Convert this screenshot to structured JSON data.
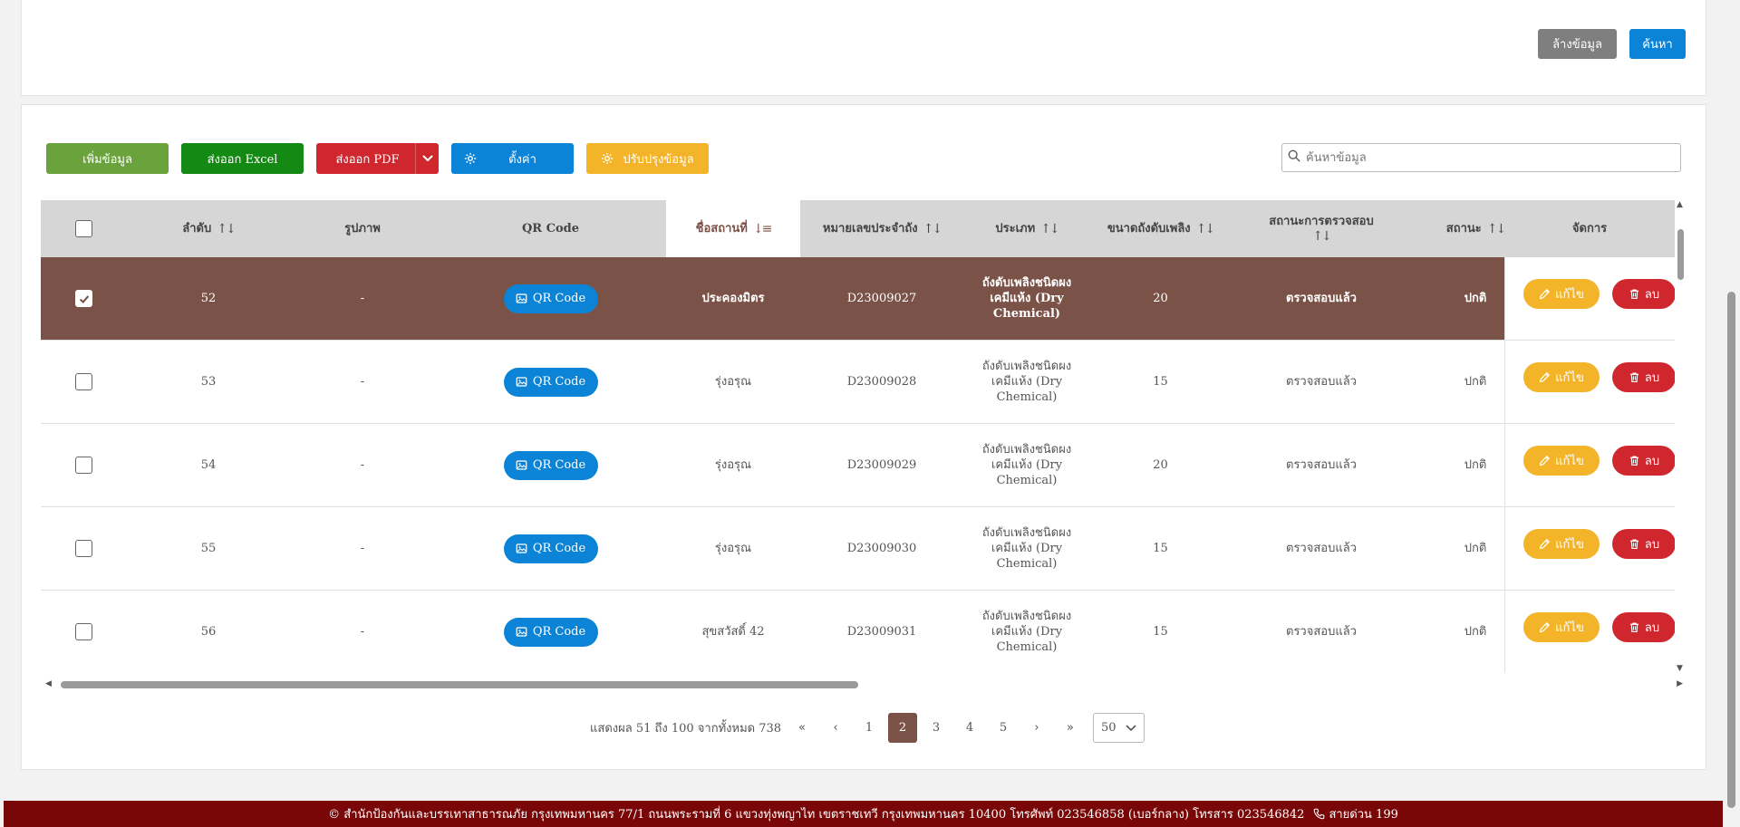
{
  "filter": {
    "clear_label": "ล้างข้อมูล",
    "search_label": "ค้นหา"
  },
  "toolbar": {
    "add_label": "เพิ่มข้อมูล",
    "excel_label": "ส่งออก Excel",
    "pdf_label": "ส่งออก PDF",
    "settings_label": "ตั้งค่า",
    "update_label": "ปรับปรุงข้อมูล",
    "search_placeholder": "ค้นหาข้อมูล"
  },
  "table": {
    "headers": {
      "order": "ลำดับ",
      "image": "รูปภาพ",
      "qr": "QR Code",
      "location": "ชื่อสถานที่",
      "tank_no": "หมายเลขประจำถัง",
      "type": "ประเภท",
      "size": "ขนาดถังดับเพลิง",
      "inspection_l1": "สถานะการตรวจสอบ",
      "status": "สถานะ",
      "manage": "จัดการ"
    },
    "sorted_column": "location",
    "qr_button_label": "QR Code",
    "edit_label": "แก้ไข",
    "delete_label": "ลบ",
    "rows": [
      {
        "selected": true,
        "order": "52",
        "image": "-",
        "location": "ประคองมิตร",
        "tank_no": "D23009027",
        "type_l1": "ถังดับเพลิงชนิดผง",
        "type_l2": "เคมีแห้ง (Dry",
        "type_l3": "Chemical)",
        "size": "20",
        "inspection": "ตรวจสอบแล้ว",
        "status": "ปกติ"
      },
      {
        "selected": false,
        "order": "53",
        "image": "-",
        "location": "รุ่งอรุณ",
        "tank_no": "D23009028",
        "type_l1": "ถังดับเพลิงชนิดผง",
        "type_l2": "เคมีแห้ง (Dry",
        "type_l3": "Chemical)",
        "size": "15",
        "inspection": "ตรวจสอบแล้ว",
        "status": "ปกติ"
      },
      {
        "selected": false,
        "order": "54",
        "image": "-",
        "location": "รุ่งอรุณ",
        "tank_no": "D23009029",
        "type_l1": "ถังดับเพลิงชนิดผง",
        "type_l2": "เคมีแห้ง (Dry",
        "type_l3": "Chemical)",
        "size": "20",
        "inspection": "ตรวจสอบแล้ว",
        "status": "ปกติ"
      },
      {
        "selected": false,
        "order": "55",
        "image": "-",
        "location": "รุ่งอรุณ",
        "tank_no": "D23009030",
        "type_l1": "ถังดับเพลิงชนิดผง",
        "type_l2": "เคมีแห้ง (Dry",
        "type_l3": "Chemical)",
        "size": "15",
        "inspection": "ตรวจสอบแล้ว",
        "status": "ปกติ"
      },
      {
        "selected": false,
        "order": "56",
        "image": "-",
        "location": "สุขสวัสดิ์ 42",
        "tank_no": "D23009031",
        "type_l1": "ถังดับเพลิงชนิดผง",
        "type_l2": "เคมีแห้ง (Dry",
        "type_l3": "Chemical)",
        "size": "15",
        "inspection": "ตรวจสอบแล้ว",
        "status": "ปกติ"
      }
    ]
  },
  "pagination": {
    "info": "แสดงผล 51 ถึง 100 จากทั้งหมด 738",
    "first": "«",
    "prev": "‹",
    "pages": [
      "1",
      "2",
      "3",
      "4",
      "5"
    ],
    "active_page": "2",
    "next": "›",
    "last": "»",
    "page_size": "50"
  },
  "footer": {
    "text": "© สำนักป้องกันและบรรเทาสาธารณภัย กรุงเทพมหานคร 77/1 ถนนพระรามที่ 6 แขวงทุ่งพญาไท เขตราชเทวี กรุงเทพมหานคร 10400 โทรศัพท์ 023546858 (เบอร์กลาง) โทรสาร 023546842",
    "hotline": "สายด่วน 199"
  },
  "colors": {
    "selected_row": "#7b5247",
    "primary": "#0b84d8",
    "success": "#6aa33b",
    "excel": "#148a14",
    "danger": "#d0262e",
    "warning": "#f4b42a",
    "footer": "#7a0707"
  }
}
